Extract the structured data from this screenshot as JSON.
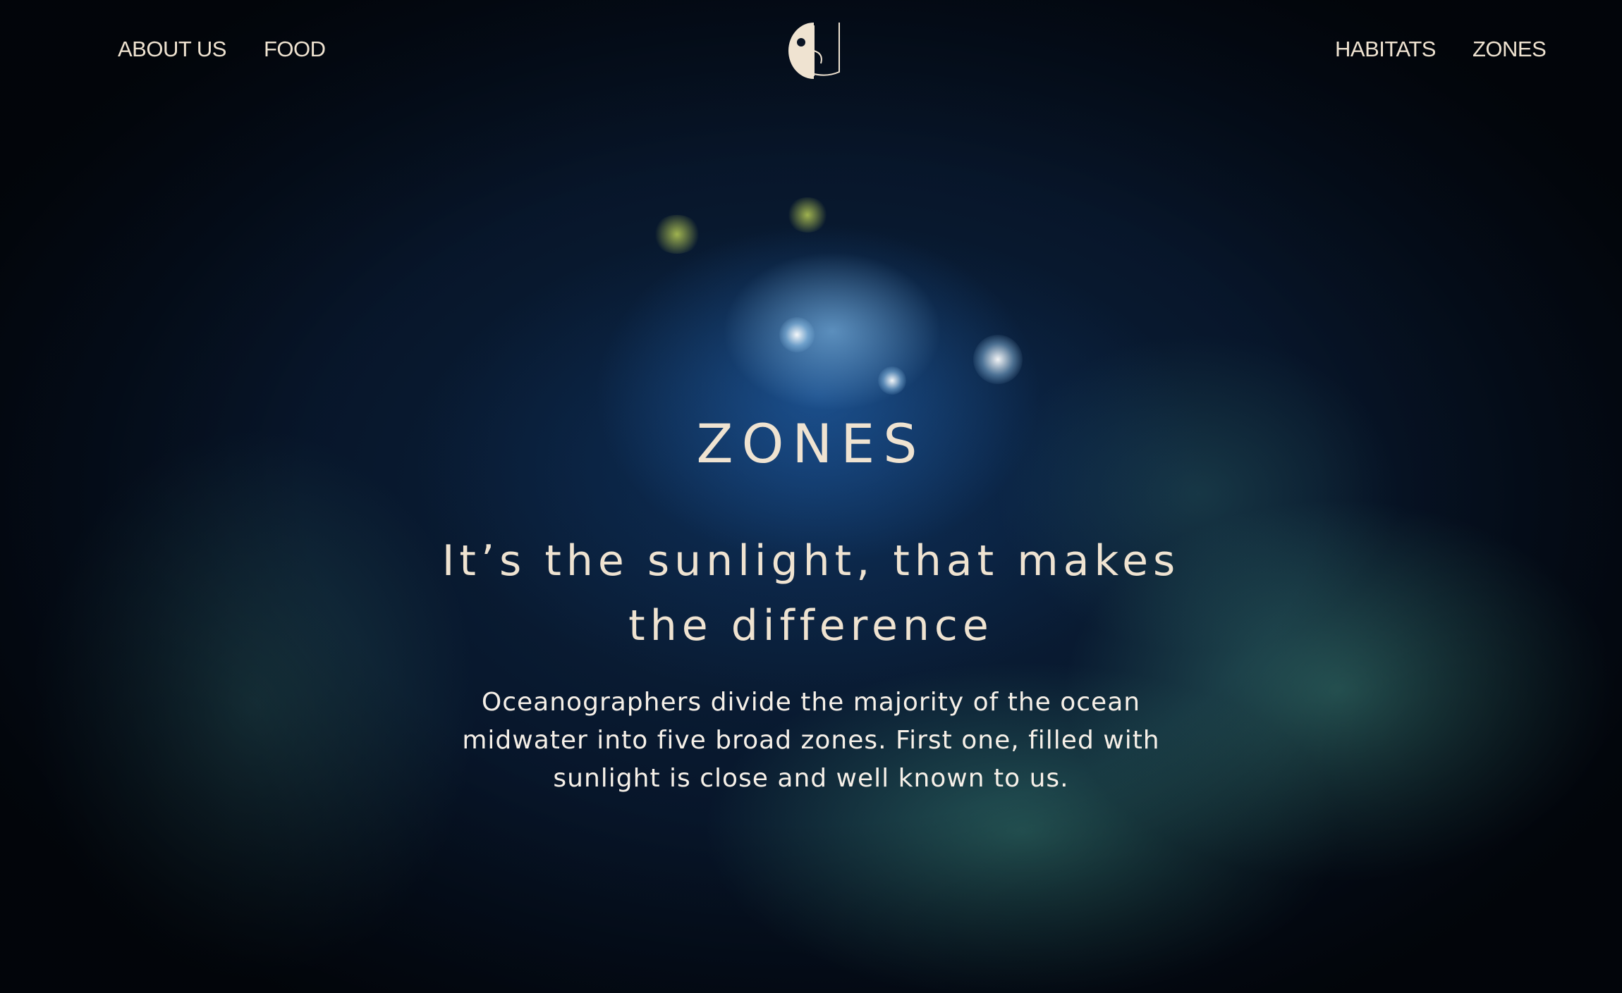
{
  "nav": {
    "left": [
      {
        "label": "ABOUT US"
      },
      {
        "label": "FOOD"
      }
    ],
    "right": [
      {
        "label": "HABITATS"
      },
      {
        "label": "ZONES"
      }
    ],
    "logo_icon": "fish-face-logo-icon"
  },
  "hero": {
    "title": "ZONES",
    "subtitle_lines": [
      "It’s the sunlight, that makes",
      "the difference"
    ],
    "body_lines": [
      "Oceanographers divide the majority of the ocean",
      "midwater into five broad zones. First one, filled with",
      "sunlight is close and well known to us."
    ]
  },
  "colors": {
    "text": "#efe3d1",
    "background": "#050b16",
    "accent_teal": "#3c877c"
  }
}
